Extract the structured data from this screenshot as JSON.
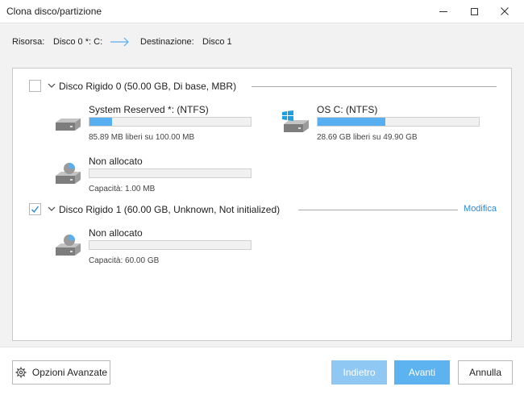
{
  "window": {
    "title": "Clona disco/partizione"
  },
  "topbar": {
    "source_label": "Risorsa:",
    "source_value": "Disco 0 *: C:",
    "dest_label": "Destinazione:",
    "dest_value": "Disco 1"
  },
  "disks": [
    {
      "label": "Disco Rigido 0 (50.00 GB, Di base, MBR)",
      "checked": false,
      "partitions": [
        {
          "name": "System Reserved *: (NTFS)",
          "info": "85.89 MB liberi su 100.00 MB",
          "used_fraction": 0.14,
          "icon": "hard-drive-icon"
        },
        {
          "name": "OS C: (NTFS)",
          "info": "28.69 GB liberi su 49.90 GB",
          "used_fraction": 0.42,
          "icon": "windows-drive-icon"
        },
        {
          "name": "Non allocato",
          "info": "Capacità: 1.00 MB",
          "used_fraction": 0,
          "icon": "unallocated-disk-icon"
        }
      ]
    },
    {
      "label": "Disco Rigido 1 (60.00 GB, Unknown, Not initialized)",
      "checked": true,
      "modify_label": "Modifica",
      "partitions": [
        {
          "name": "Non allocato",
          "info": "Capacità: 60.00 GB",
          "used_fraction": 0,
          "icon": "unallocated-disk-icon"
        }
      ]
    }
  ],
  "footer": {
    "advanced_label": "Opzioni Avanzate",
    "back_label": "Indietro",
    "next_label": "Avanti",
    "cancel_label": "Annulla"
  },
  "colors": {
    "accent": "#5cb3f0",
    "accent_disabled": "#8fc9f3",
    "link": "#2a8ad6",
    "bar_fill": "#57aef0"
  }
}
